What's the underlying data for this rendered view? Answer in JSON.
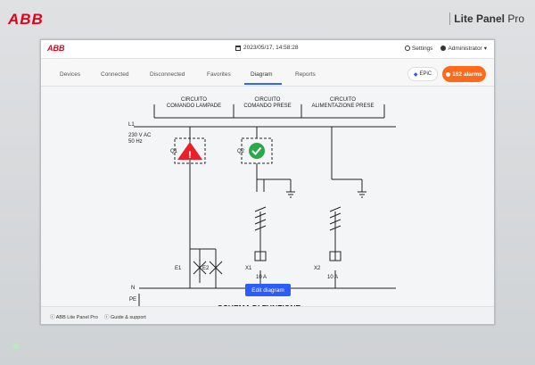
{
  "bezel": {
    "brand": "ABB",
    "product_name": "Lite Panel",
    "product_suffix": "Pro"
  },
  "app": {
    "logo": "ABB",
    "datetime": "2023/05/17, 14:58:28",
    "settings_label": "Settings",
    "user_label": "Administrator"
  },
  "nav": {
    "tabs": [
      "Devices",
      "Connected",
      "Disconnected",
      "Favorites",
      "Diagram",
      "Reports"
    ],
    "active_tab": "Diagram",
    "epic_label": "EPiC",
    "alarms_label": "162 alarms"
  },
  "diagram": {
    "sections": [
      {
        "line1": "CIRCUITO",
        "line2": "COMANDO LAMPADE"
      },
      {
        "line1": "CIRCUITO",
        "line2": "COMANDO PRESE"
      },
      {
        "line1": "CIRCUITO",
        "line2": "ALIMENTAZIONE PRESE"
      }
    ],
    "l1_label": "L1",
    "voltage_label": "230 V AC",
    "freq_label": "50 Hz",
    "q1_label": "Q1",
    "q2_label": "Q2",
    "q1_status": "alarm",
    "q2_status": "ok",
    "e1_label": "E1",
    "e2_label": "E2",
    "x1_label": "X1",
    "x1_rating": "10 A",
    "x2_label": "X2",
    "x2_rating": "10 A",
    "n_label": "N",
    "pe_label": "PE",
    "title": "SCHEMA DI FUNZIONE",
    "edit_button": "Edit diagram",
    "colors": {
      "alarm": "#e8202a",
      "ok": "#2aa84a"
    }
  },
  "footer": {
    "product": "ABB Lite Panel Pro",
    "support": "Guide & support"
  }
}
